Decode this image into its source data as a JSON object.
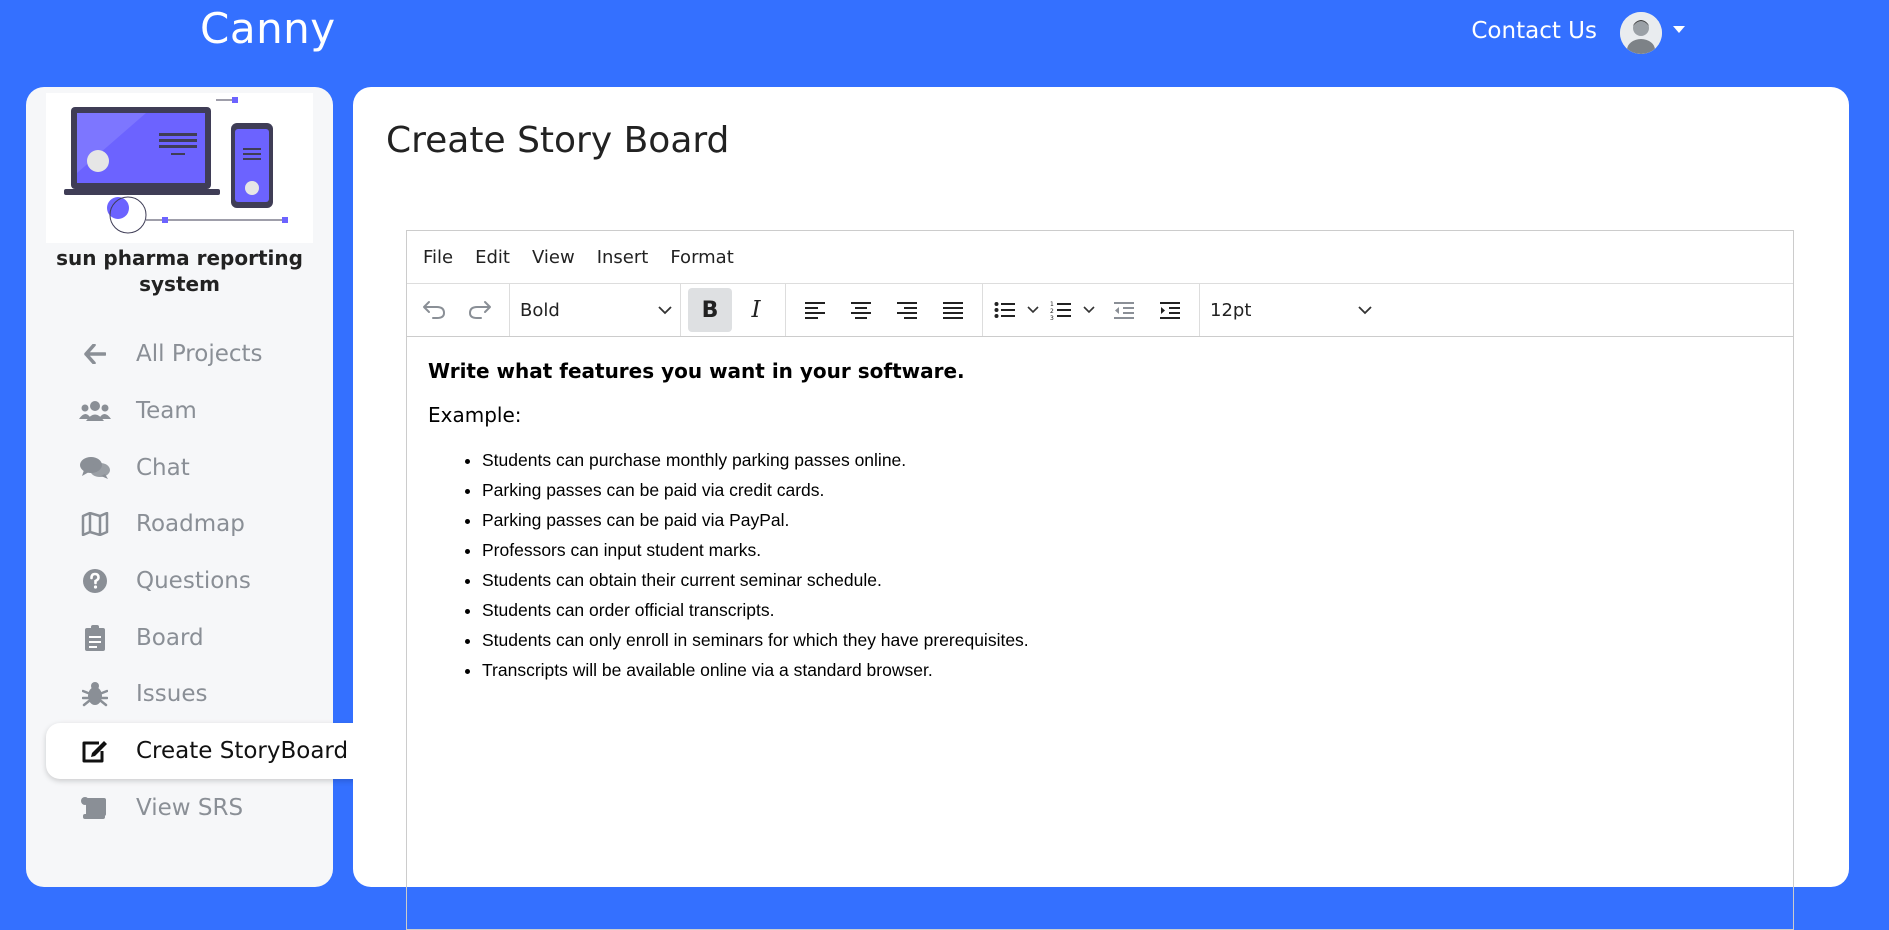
{
  "header": {
    "brand": "Canny",
    "contact_label": "Contact Us"
  },
  "sidebar": {
    "org_name": "sun pharma reporting system",
    "items": [
      {
        "label": "All Projects",
        "icon": "arrow-left-icon"
      },
      {
        "label": "Team",
        "icon": "users-icon"
      },
      {
        "label": "Chat",
        "icon": "comments-icon"
      },
      {
        "label": "Roadmap",
        "icon": "map-icon"
      },
      {
        "label": "Questions",
        "icon": "question-circle-icon"
      },
      {
        "label": "Board",
        "icon": "clipboard-icon"
      },
      {
        "label": "Issues",
        "icon": "bug-icon"
      },
      {
        "label": "Create StoryBoard",
        "icon": "edit-icon",
        "active": true
      },
      {
        "label": "View SRS",
        "icon": "scroll-icon"
      }
    ]
  },
  "main": {
    "title": "Create Story Board"
  },
  "editor": {
    "menu": [
      "File",
      "Edit",
      "View",
      "Insert",
      "Format"
    ],
    "block_format": "Bold",
    "font_size": "12pt",
    "intro": "Write what features you want in your software.",
    "example_label": "Example:",
    "items": [
      "Students can purchase monthly parking passes online.",
      "Parking passes can be paid via credit cards.",
      "Parking passes can be paid via PayPal.",
      "Professors can input student marks.",
      "Students can obtain their current seminar schedule.",
      "Students can order official transcripts.",
      "Students can only enroll in seminars for which they have prerequisites.",
      "Transcripts will be available online via a standard browser."
    ]
  },
  "colors": {
    "brand_blue": "#3470ff",
    "sidebar_bg": "#f6f7f9",
    "illustration_accent": "#6c63ff"
  }
}
